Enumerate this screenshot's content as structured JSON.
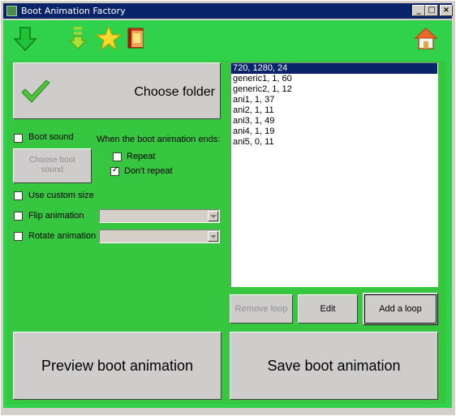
{
  "window": {
    "title": "Boot Animation Factory"
  },
  "toolbar": {
    "icons": [
      "down-arrow-icon",
      "download-icon",
      "star-icon",
      "book-icon",
      "home-icon"
    ]
  },
  "choose_folder": {
    "label": "Choose folder"
  },
  "boot_sound": {
    "label": "Boot sound",
    "checked": false
  },
  "ends": {
    "heading": "When the boot animation ends:",
    "repeat_label": "Repeat",
    "dont_repeat_label": "Don't repeat",
    "selected": "dont_repeat"
  },
  "choose_boot_sound": {
    "line1": "Choose boot",
    "line2": "sound"
  },
  "custom_size": {
    "label": "Use custom size",
    "checked": false
  },
  "flip": {
    "label": "Flip animation",
    "checked": false,
    "value": ""
  },
  "rotate": {
    "label": "Rotate animation",
    "checked": false,
    "value": ""
  },
  "list": {
    "items": [
      "720, 1280, 24",
      "generic1, 1, 60",
      "generic2, 1, 12",
      "ani1, 1, 37",
      "ani2, 1, 11",
      "ani3, 1, 49",
      "ani4, 1, 19",
      "ani5, 0, 11"
    ],
    "selected_index": 0
  },
  "buttons": {
    "remove_loop": "Remove loop",
    "edit": "Edit",
    "add_loop": "Add a loop",
    "preview": "Preview boot animation",
    "save": "Save boot animation"
  },
  "colors": {
    "background": "#2fd24a",
    "panel": "#37c63f",
    "titlebar": "#0a246a",
    "selection": "#0a246a"
  }
}
